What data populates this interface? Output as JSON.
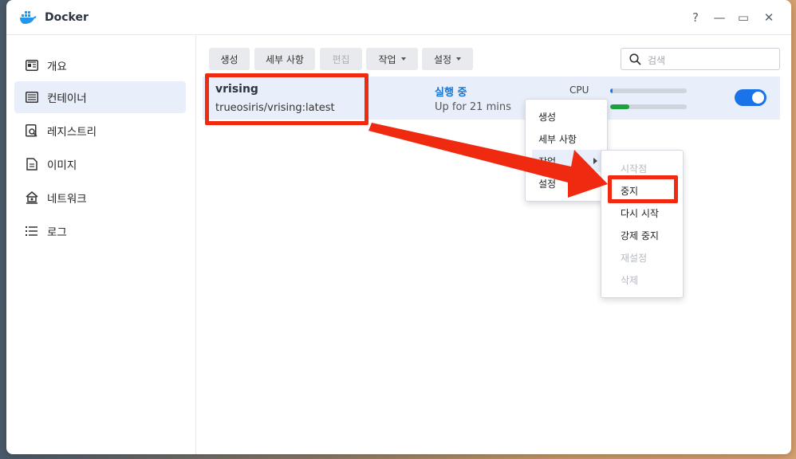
{
  "window": {
    "title": "Docker"
  },
  "controls": {
    "help": "?",
    "minimize": "—",
    "maximize": "▭",
    "close": "✕"
  },
  "sidebar": {
    "items": [
      {
        "label": "개요",
        "icon": "overview-icon"
      },
      {
        "label": "컨테이너",
        "icon": "container-icon",
        "active": true
      },
      {
        "label": "레지스트리",
        "icon": "registry-icon"
      },
      {
        "label": "이미지",
        "icon": "image-icon"
      },
      {
        "label": "네트워크",
        "icon": "network-icon"
      },
      {
        "label": "로그",
        "icon": "log-icon"
      }
    ]
  },
  "toolbar": {
    "create": "생성",
    "details": "세부 사항",
    "edit": "편집",
    "action": "작업",
    "settings": "설정"
  },
  "search": {
    "placeholder": "검색"
  },
  "container": {
    "name": "vrising",
    "image": "trueosiris/vrising:latest",
    "status": "실행 중",
    "uptime": "Up for 21 mins",
    "cpu_label": "CPU",
    "cpu_usage": 0.03,
    "ram_usage": 0.25,
    "running": true
  },
  "context_menu": {
    "items": [
      "생성",
      "세부 사항",
      "작업",
      "설정"
    ]
  },
  "submenu": {
    "items": [
      {
        "label": "시작점",
        "disabled": true
      },
      {
        "label": "중지",
        "disabled": false
      },
      {
        "label": "다시 시작",
        "disabled": false
      },
      {
        "label": "강제 중지",
        "disabled": false
      },
      {
        "label": "재설정",
        "disabled": true
      },
      {
        "label": "삭제",
        "disabled": true
      }
    ]
  },
  "colors": {
    "accent": "#1a73e8",
    "annotation": "#f02a10",
    "status_running": "#1a73d0",
    "ram_bar": "#1aa33c"
  }
}
